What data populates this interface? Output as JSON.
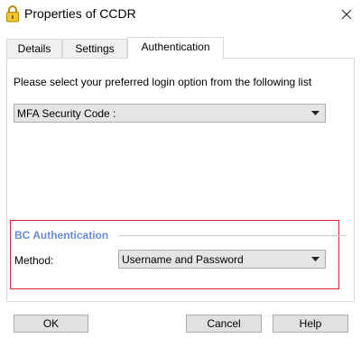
{
  "window": {
    "title": "Properties of CCDR",
    "title_icon": "padlock-icon",
    "close_icon": "close-icon"
  },
  "tabs": [
    {
      "label": "Details",
      "active": false
    },
    {
      "label": "Settings",
      "active": false
    },
    {
      "label": "Authentication",
      "active": true
    }
  ],
  "auth": {
    "prompt": "Please select your preferred  login option from the following list",
    "login_option": {
      "value": "MFA Security Code :"
    }
  },
  "bc_auth": {
    "group_title": "BC Authentication",
    "method_label": "Method:",
    "method_value": "Username and Password",
    "highlight_color": "#d9262e",
    "title_color": "#6a8dd4"
  },
  "buttons": {
    "ok": "OK",
    "cancel": "Cancel",
    "help": "Help"
  }
}
